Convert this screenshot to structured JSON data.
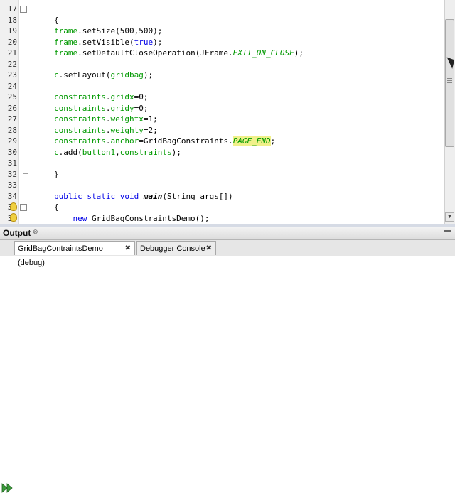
{
  "editor": {
    "lines": [
      {
        "num": "17",
        "fold": true
      },
      {
        "num": "18",
        "code": [
          {
            "t": "{"
          }
        ]
      },
      {
        "num": "19",
        "code": [
          {
            "t": "frame",
            "c": "fld"
          },
          {
            "t": ".setSize(500,500);"
          }
        ]
      },
      {
        "num": "20",
        "code": [
          {
            "t": "frame",
            "c": "fld"
          },
          {
            "t": ".setVisible("
          },
          {
            "t": "true",
            "c": "kw"
          },
          {
            "t": ");"
          }
        ]
      },
      {
        "num": "21",
        "code": [
          {
            "t": "frame",
            "c": "fld"
          },
          {
            "t": ".setDefaultCloseOperation(JFrame."
          },
          {
            "t": "EXIT_ON_CLOSE",
            "c": "const"
          },
          {
            "t": ");"
          }
        ]
      },
      {
        "num": "22"
      },
      {
        "num": "23",
        "code": [
          {
            "t": "c",
            "c": "fld"
          },
          {
            "t": ".setLayout("
          },
          {
            "t": "gridbag",
            "c": "fld"
          },
          {
            "t": ");"
          }
        ]
      },
      {
        "num": "24"
      },
      {
        "num": "25",
        "code": [
          {
            "t": "constraints",
            "c": "fld"
          },
          {
            "t": "."
          },
          {
            "t": "gridx",
            "c": "fld"
          },
          {
            "t": "=0;"
          }
        ]
      },
      {
        "num": "26",
        "code": [
          {
            "t": "constraints",
            "c": "fld"
          },
          {
            "t": "."
          },
          {
            "t": "gridy",
            "c": "fld"
          },
          {
            "t": "=0;"
          }
        ]
      },
      {
        "num": "27",
        "code": [
          {
            "t": "constraints",
            "c": "fld"
          },
          {
            "t": "."
          },
          {
            "t": "weightx",
            "c": "fld"
          },
          {
            "t": "=1;"
          }
        ]
      },
      {
        "num": "28",
        "code": [
          {
            "t": "constraints",
            "c": "fld"
          },
          {
            "t": "."
          },
          {
            "t": "weighty",
            "c": "fld"
          },
          {
            "t": "=2;"
          }
        ]
      },
      {
        "num": "29",
        "code": [
          {
            "t": "constraints",
            "c": "fld"
          },
          {
            "t": "."
          },
          {
            "t": "anchor",
            "c": "fld"
          },
          {
            "t": "=GridBagConstraints."
          },
          {
            "t": "PAGE_END",
            "c": "const hl"
          },
          {
            "t": ";"
          }
        ]
      },
      {
        "num": "30",
        "code": [
          {
            "t": "c",
            "c": "fld"
          },
          {
            "t": ".add("
          },
          {
            "t": "button1",
            "c": "fld"
          },
          {
            "t": ","
          },
          {
            "t": "constraints",
            "c": "fld"
          },
          {
            "t": ");"
          }
        ]
      },
      {
        "num": "31"
      },
      {
        "num": "32",
        "code": [
          {
            "t": "}"
          }
        ]
      },
      {
        "num": "33"
      },
      {
        "num": "34",
        "code": [
          {
            "t": "public static void ",
            "c": "kw"
          },
          {
            "t": "main",
            "c": "mb"
          },
          {
            "t": "(String args[])"
          }
        ]
      },
      {
        "num": "35",
        "fold": true,
        "code": [
          {
            "t": "{"
          }
        ]
      },
      {
        "num": "36",
        "indent": 4,
        "code": [
          {
            "t": "new ",
            "c": "kw"
          },
          {
            "t": "GridBagConstraintsDemo();"
          }
        ]
      }
    ]
  },
  "output": {
    "title": "Output",
    "close_glyph": "⊗",
    "tabs": [
      {
        "label": "GridBagContraintsDemo (debug)",
        "close": "✖"
      },
      {
        "label": "Debugger Console",
        "close": "✖"
      }
    ]
  },
  "colors": {
    "keyword": "#0000e6",
    "field": "#009900",
    "highlight": "#f0f08a"
  }
}
